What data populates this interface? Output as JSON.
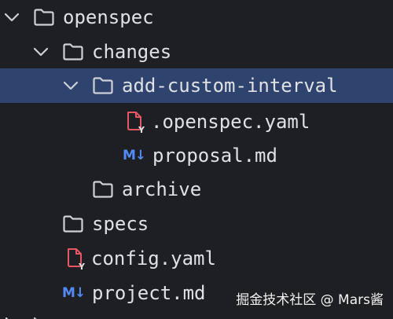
{
  "tree": {
    "items": [
      {
        "label": "openspec",
        "type": "folder",
        "expanded": true
      },
      {
        "label": "changes",
        "type": "folder",
        "expanded": true
      },
      {
        "label": "add-custom-interval",
        "type": "folder",
        "expanded": true,
        "selected": true
      },
      {
        "label": ".openspec.yaml",
        "type": "yaml"
      },
      {
        "label": "proposal.md",
        "type": "markdown",
        "icon_text": "M↓"
      },
      {
        "label": "archive",
        "type": "folder",
        "expanded": false
      },
      {
        "label": "specs",
        "type": "folder",
        "expanded": false
      },
      {
        "label": "config.yaml",
        "type": "yaml"
      },
      {
        "label": "project.md",
        "type": "markdown",
        "icon_text": "M↓"
      }
    ]
  },
  "watermark": "掘金技术社区 @ Mars酱",
  "colors": {
    "background": "#1e1f22",
    "selection": "#2e436e",
    "text": "#dfe1e5",
    "folder_stroke": "#ced0d6",
    "yaml_red": "#e55765",
    "markdown_blue": "#548af7"
  },
  "icons": {
    "chevron_down": "chevron-down-icon",
    "folder": "folder-icon",
    "yaml": "yaml-file-icon",
    "markdown": "markdown-file-icon"
  }
}
